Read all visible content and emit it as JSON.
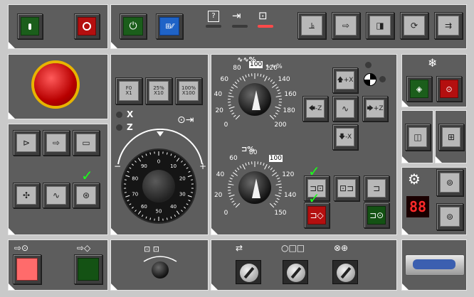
{
  "top_left": {
    "start_icon": "cycle-start-icon",
    "stop_icon": "cycle-stop-icon"
  },
  "top_bar": {
    "power_icon": "power-icon",
    "question_label": "?",
    "indicators": [
      "help-icon",
      "jog-arrow-icon",
      "tool-icon"
    ],
    "right_buttons": [
      "machine-icon",
      "program-icon",
      "feed-icon",
      "rotate-icon",
      "fast-forward-icon"
    ]
  },
  "feed_buttons": [
    {
      "top": "F0",
      "bottom": "X1"
    },
    {
      "top": "25%",
      "bottom": "X10"
    },
    {
      "top": "100%",
      "bottom": "X100"
    }
  ],
  "axis_labels": {
    "x": "X",
    "z": "Z"
  },
  "handwheel": {
    "minus": "−",
    "plus": "+",
    "ticks": [
      "0",
      "10",
      "20",
      "30",
      "40",
      "50",
      "60",
      "70",
      "80",
      "90"
    ]
  },
  "feed_override": {
    "top_scale": [
      "0",
      "20",
      "40",
      "60",
      "80",
      "100",
      "120",
      "140",
      "160",
      "180",
      "200"
    ],
    "symbol": "%",
    "top_symbol": "∿∿%",
    "extra": "∿∿%"
  },
  "spindle_override": {
    "scale": [
      "0",
      "20",
      "40",
      "60",
      "80",
      "100",
      "120",
      "140",
      "150"
    ],
    "symbol": "%"
  },
  "jog": {
    "plus_x": "+X",
    "minus_z": "-Z",
    "plus_z": "+Z",
    "minus_x": "-X",
    "wave": "∿"
  },
  "right": {
    "digits": "88"
  },
  "bottom": {
    "key_labels": [
      "⇄",
      "○□□",
      "⊗⊕"
    ]
  }
}
